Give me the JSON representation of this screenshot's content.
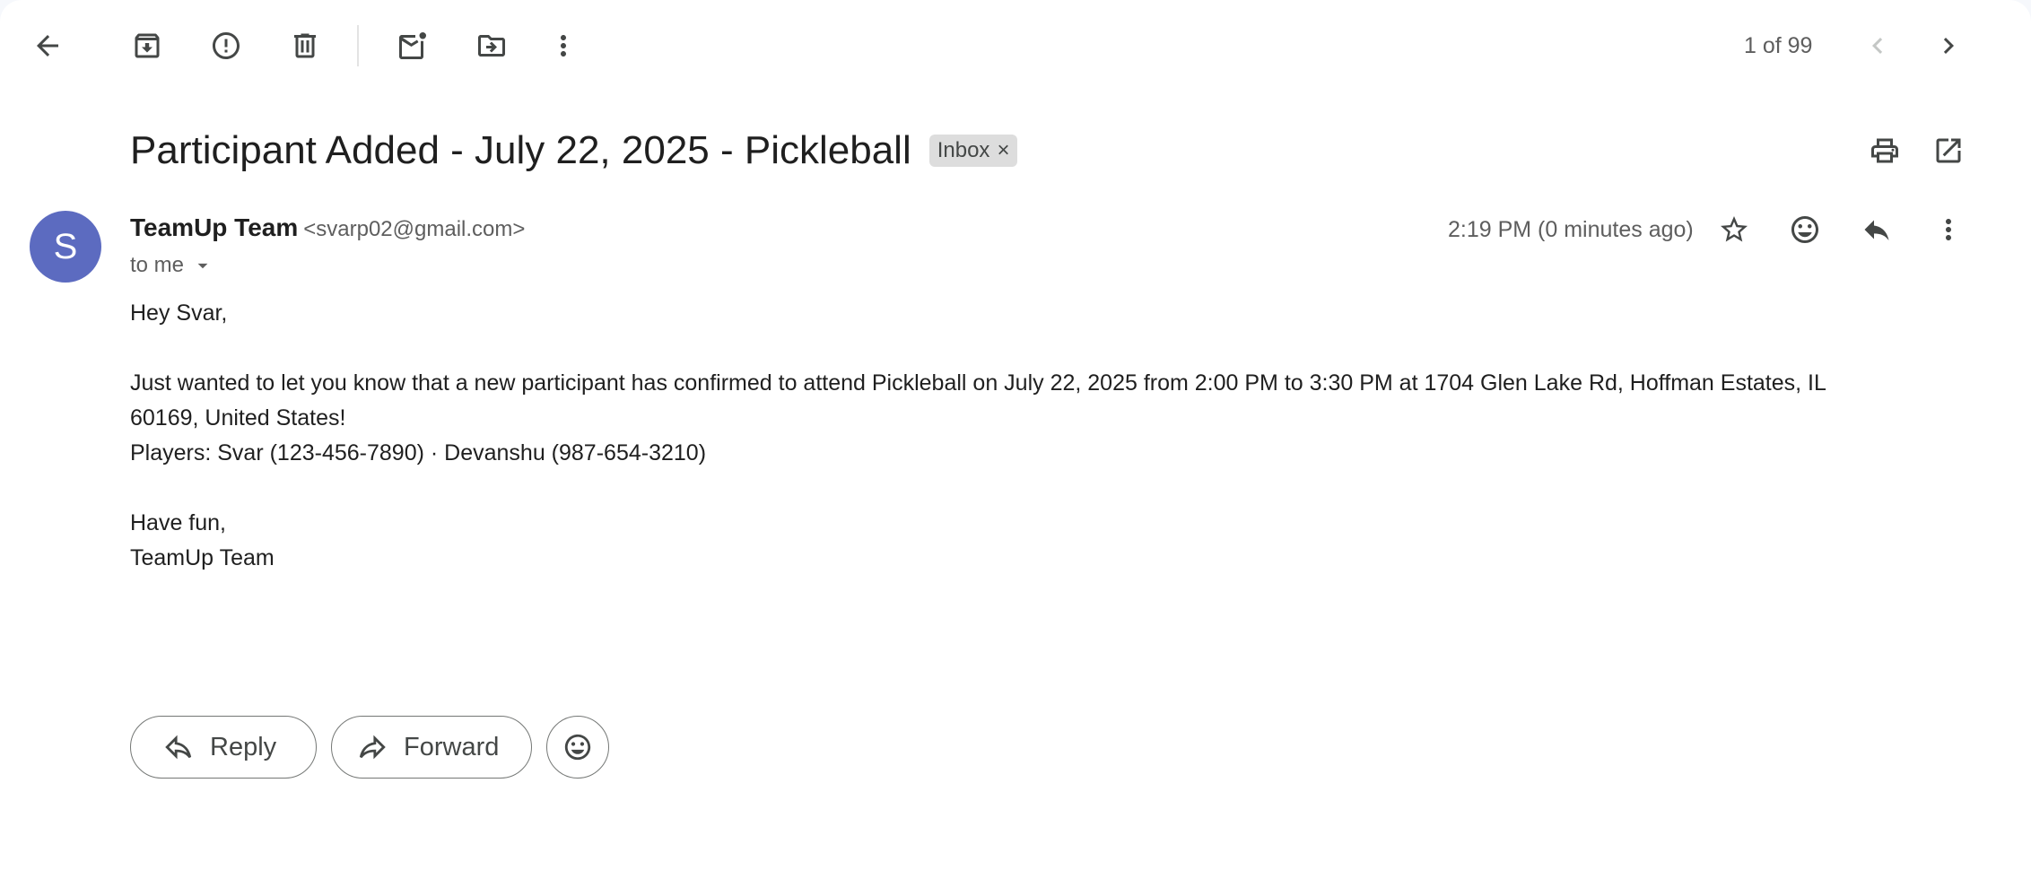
{
  "toolbar": {
    "back_icon": "arrow-back-icon",
    "archive_icon": "archive-icon",
    "spam_icon": "report-spam-icon",
    "delete_icon": "trash-icon",
    "mark_unread_icon": "mark-unread-icon",
    "move_icon": "move-to-folder-icon",
    "more_icon": "more-vertical-icon",
    "pager": "1 of 99",
    "prev_icon": "chevron-left-icon",
    "next_icon": "chevron-right-icon"
  },
  "subject": {
    "title": "Participant Added - July 22, 2025 - Pickleball",
    "label": "Inbox",
    "label_remove": "×",
    "print_icon": "print-icon",
    "new_window_icon": "open-in-new-icon"
  },
  "message": {
    "avatar_letter": "S",
    "avatar_color": "#5c6bc0",
    "sender_name": "TeamUp Team",
    "sender_email": "<svarp02@gmail.com>",
    "recipients": "to me",
    "time": "2:19 PM (0 minutes ago)",
    "body": {
      "greeting": "Hey Svar,",
      "line1": "Just wanted to let you know that a new participant has confirmed to attend Pickleball on July 22, 2025 from 2:00 PM to 3:30 PM at 1704 Glen Lake Rd, Hoffman Estates, IL",
      "line2": "60169, United States!",
      "players": "Players: Svar (123-456-7890) · Devanshu (987-654-3210)",
      "closing": "Have fun,",
      "signature": "TeamUp Team"
    }
  },
  "actions": {
    "reply": "Reply",
    "forward": "Forward"
  }
}
